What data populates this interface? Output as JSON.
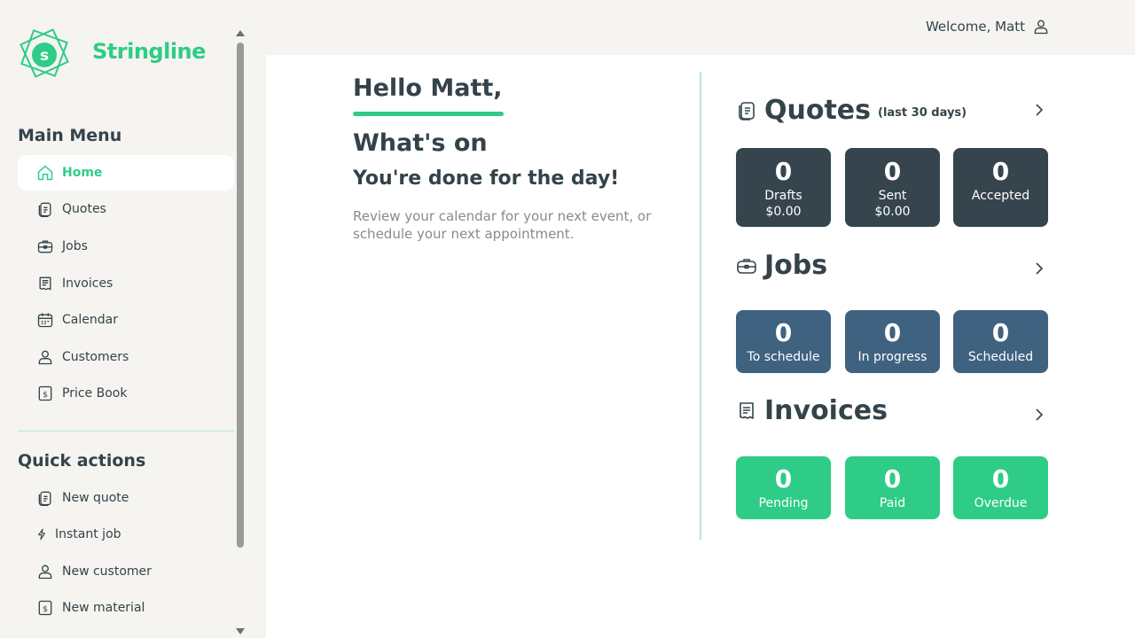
{
  "brand": {
    "name": "Stringline",
    "logo_letter": "s"
  },
  "header": {
    "welcome": "Welcome, Matt"
  },
  "sidebar": {
    "main_menu_title": "Main Menu",
    "main_menu": [
      {
        "label": "Home",
        "icon": "home-icon",
        "active": true
      },
      {
        "label": "Quotes",
        "icon": "document-icon"
      },
      {
        "label": "Jobs",
        "icon": "briefcase-icon"
      },
      {
        "label": "Invoices",
        "icon": "receipt-icon"
      },
      {
        "label": "Calendar",
        "icon": "calendar-icon"
      },
      {
        "label": "Customers",
        "icon": "user-icon"
      },
      {
        "label": "Price Book",
        "icon": "dollar-icon"
      }
    ],
    "quick_actions_title": "Quick actions",
    "quick_actions": [
      {
        "label": "New quote",
        "icon": "document-icon"
      },
      {
        "label": "Instant job",
        "icon": "lightning-icon"
      },
      {
        "label": "New customer",
        "icon": "user-icon"
      },
      {
        "label": "New material",
        "icon": "dollar-icon"
      }
    ]
  },
  "main": {
    "hello": "Hello Matt,",
    "whats_on": "What's on",
    "done": "You're done for the day!",
    "review": "Review your calendar for your next event, or schedule your next appointment."
  },
  "quotes": {
    "title": "Quotes",
    "subtitle": "(last 30 days)",
    "cards": [
      {
        "value": "0",
        "label": "Drafts",
        "amount": "$0.00"
      },
      {
        "value": "0",
        "label": "Sent",
        "amount": "$0.00"
      },
      {
        "value": "0",
        "label": "Accepted",
        "amount": ""
      }
    ]
  },
  "jobs": {
    "title": "Jobs",
    "cards": [
      {
        "value": "0",
        "label": "To schedule"
      },
      {
        "value": "0",
        "label": "In progress"
      },
      {
        "value": "0",
        "label": "Scheduled"
      }
    ]
  },
  "invoices": {
    "title": "Invoices",
    "cards": [
      {
        "value": "0",
        "label": "Pending"
      },
      {
        "value": "0",
        "label": "Paid"
      },
      {
        "value": "0",
        "label": "Overdue"
      }
    ]
  },
  "colors": {
    "accent": "#2ecc87",
    "dark": "#36454d",
    "blue": "#3f6280",
    "text": "#34434a"
  }
}
